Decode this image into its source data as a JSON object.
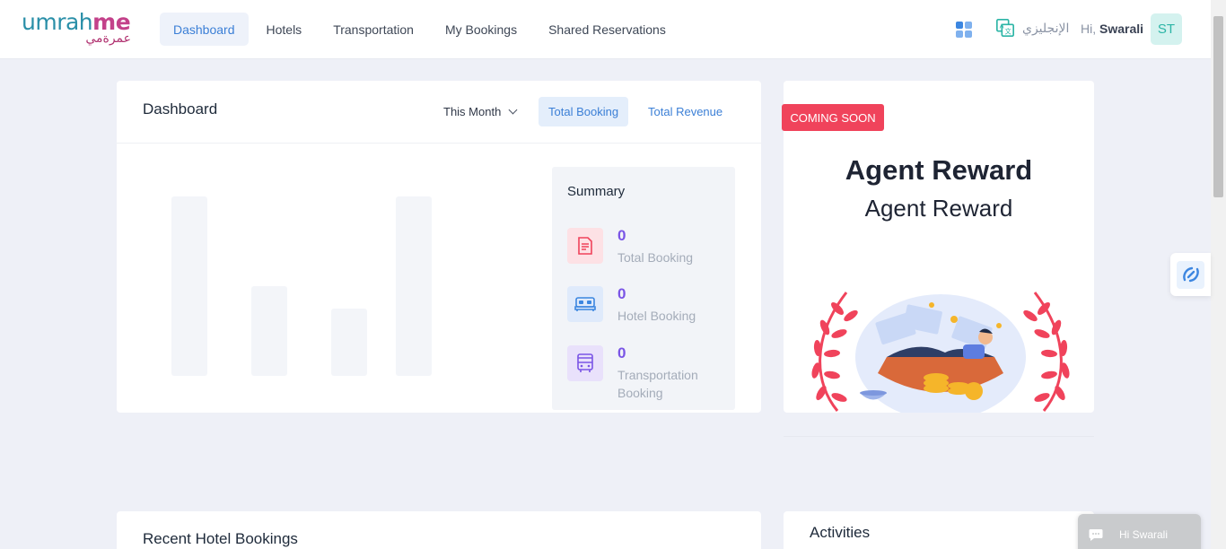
{
  "brand": {
    "logo_text": "umrahme",
    "logo_text_a": "umrah",
    "logo_text_b": "me",
    "logo_arabic": "عمرةمي"
  },
  "nav": {
    "items": [
      {
        "label": "Dashboard",
        "active": true
      },
      {
        "label": "Hotels"
      },
      {
        "label": "Transportation"
      },
      {
        "label": "My Bookings"
      },
      {
        "label": "Shared Reservations"
      }
    ]
  },
  "header": {
    "apps_icon": "grid-icon",
    "language_icon": "translate-icon",
    "language_label": "الإنجليزي",
    "greeting_prefix": "Hi,",
    "user_name": "Swarali",
    "avatar_initials": "ST"
  },
  "dashboard": {
    "title": "Dashboard",
    "period": "This Month",
    "tabs": [
      "Total Booking",
      "Total Revenue"
    ],
    "summary": {
      "title": "Summary",
      "items": [
        {
          "value": "0",
          "label": "Total Booking",
          "icon": "document-icon",
          "color": "#f0435b"
        },
        {
          "value": "0",
          "label": "Hotel Booking",
          "icon": "bed-icon",
          "color": "#3c86e0"
        },
        {
          "value": "0",
          "label": "Transportation Booking",
          "icon": "bus-icon",
          "color": "#7a55e6"
        }
      ]
    }
  },
  "chart_data": {
    "type": "bar",
    "categories": [],
    "values": [],
    "note": "placeholder skeleton bars, no data"
  },
  "reward": {
    "badge": "COMING SOON",
    "title": "Agent Reward",
    "subtitle": "Agent Reward"
  },
  "sections": {
    "recent_hotel_bookings": "Recent Hotel Bookings",
    "activities": "Activities"
  },
  "chat_widget": {
    "label": "Hi Swarali",
    "icon": "chat-icon"
  },
  "colors": {
    "accent": "#3b7fd6",
    "brand_teal": "#2a8fa8",
    "brand_pink": "#c3418a",
    "badge_red": "#f0435b",
    "value_purple": "#7a55e6"
  }
}
